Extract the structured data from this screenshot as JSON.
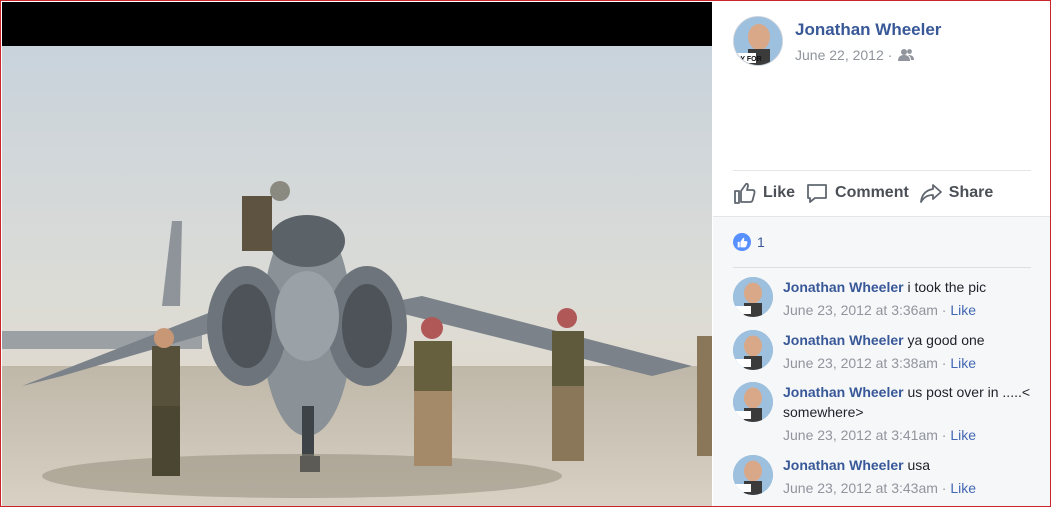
{
  "post": {
    "author": "Jonathan Wheeler",
    "date": "June 22, 2012",
    "separator": "·",
    "privacy_icon": "friends-icon"
  },
  "actions": {
    "like": "Like",
    "comment": "Comment",
    "share": "Share"
  },
  "reactions": {
    "count": "1",
    "icon": "thumbs-up-icon"
  },
  "avatar": {
    "caption": "AY FOR"
  },
  "comments": [
    {
      "author": "Jonathan Wheeler",
      "text": "i took the pic",
      "timestamp": "June 23, 2012 at 3:36am",
      "separator": "·",
      "like": "Like"
    },
    {
      "author": "Jonathan Wheeler",
      "text": "ya good one",
      "timestamp": "June 23, 2012 at 3:38am",
      "separator": "·",
      "like": "Like"
    },
    {
      "author": "Jonathan Wheeler",
      "text": "us post over in .....< somewhere>",
      "timestamp": "June 23, 2012 at 3:41am",
      "separator": "·",
      "like": "Like"
    },
    {
      "author": "Jonathan Wheeler",
      "text": "usa",
      "timestamp": "June 23, 2012 at 3:43am",
      "separator": "·",
      "like": "Like"
    }
  ],
  "colors": {
    "link_blue": "#385898",
    "accent_blue": "#4267b2",
    "meta_gray": "#90949c",
    "action_gray": "#4b4f56",
    "frame_red": "#c9262c"
  }
}
